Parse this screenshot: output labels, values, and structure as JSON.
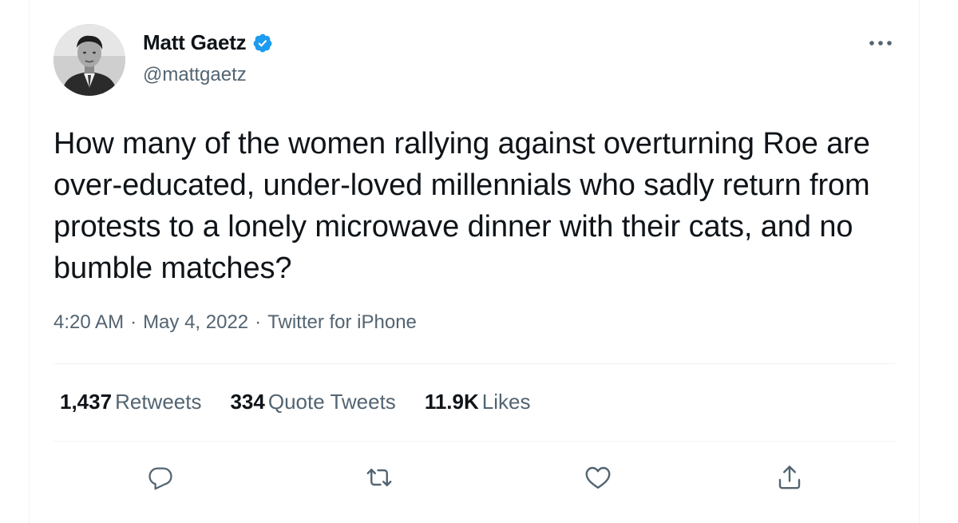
{
  "author": {
    "name": "Matt Gaetz",
    "handle": "@mattgaetz",
    "verified": true,
    "avatar_icon": "profile-photo"
  },
  "tweet": {
    "text": "How many of the women rallying against overturning Roe are over-educated, under-loved millennials who sadly return from protests to a lonely microwave dinner with their cats, and no bumble matches?",
    "time": "4:20 AM",
    "date": "May 4, 2022",
    "source": "Twitter for iPhone",
    "separator": "·"
  },
  "stats": {
    "retweets_count": "1,437",
    "retweets_label": "Retweets",
    "quotes_count": "334",
    "quotes_label": "Quote Tweets",
    "likes_count": "11.9K",
    "likes_label": "Likes"
  },
  "actions": [
    "reply-icon",
    "retweet-icon",
    "like-icon",
    "share-icon"
  ],
  "colors": {
    "verified": "#1d9bf0",
    "secondary_text": "#536471",
    "primary_text": "#0f1419",
    "divider": "#eff3f4"
  }
}
